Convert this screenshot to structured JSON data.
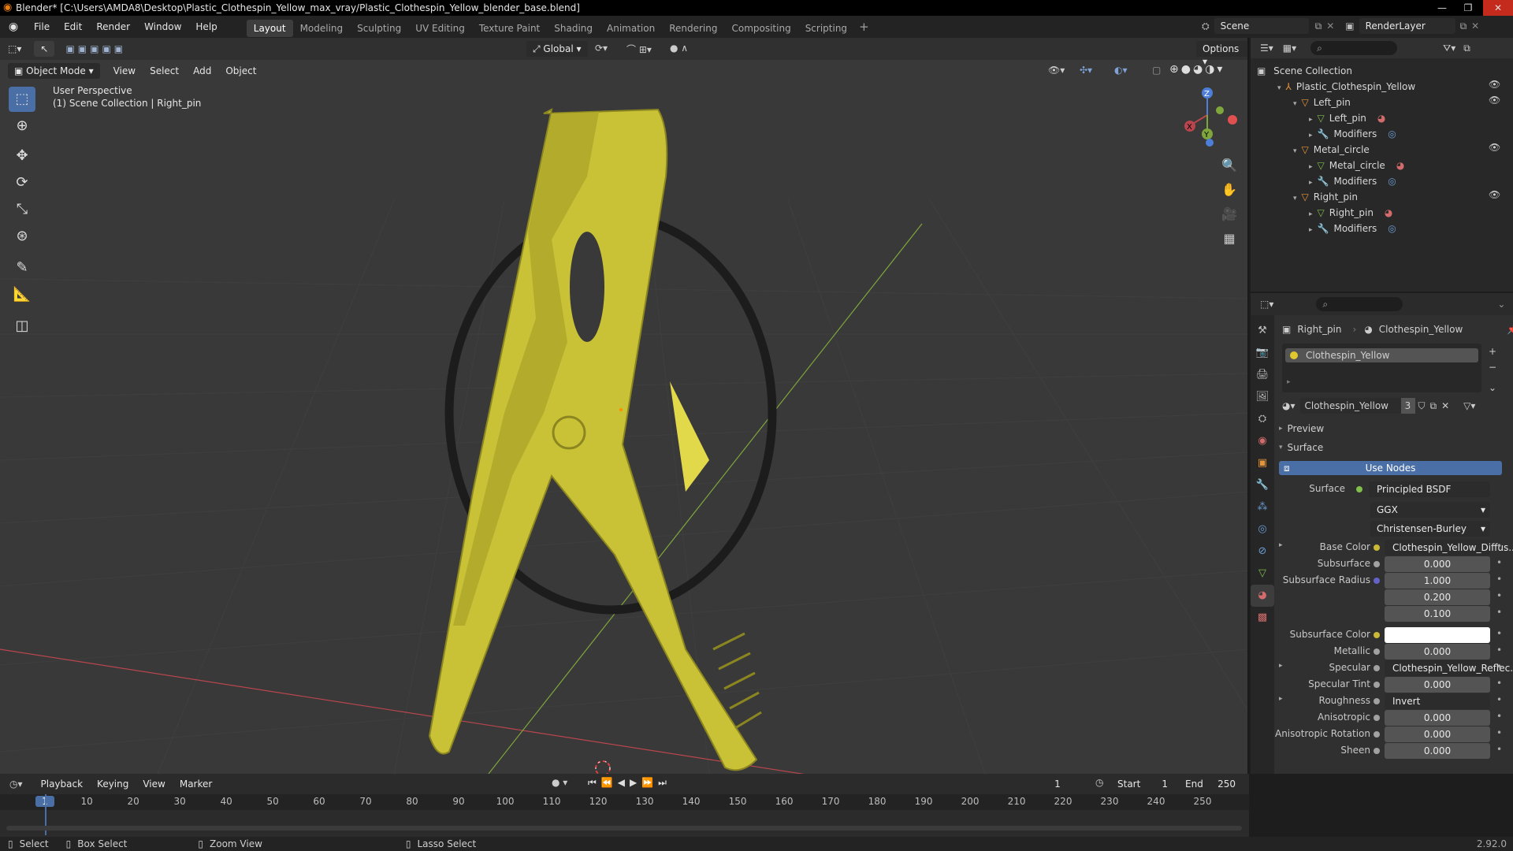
{
  "title_bar": {
    "text": "Blender* [C:\\Users\\AMDA8\\Desktop\\Plastic_Clothespin_Yellow_max_vray/Plastic_Clothespin_Yellow_blender_base.blend]"
  },
  "menu": [
    "File",
    "Edit",
    "Render",
    "Window",
    "Help"
  ],
  "workspaces": [
    {
      "label": "Layout",
      "active": true
    },
    {
      "label": "Modeling"
    },
    {
      "label": "Sculpting"
    },
    {
      "label": "UV Editing"
    },
    {
      "label": "Texture Paint"
    },
    {
      "label": "Shading"
    },
    {
      "label": "Animation"
    },
    {
      "label": "Rendering"
    },
    {
      "label": "Compositing"
    },
    {
      "label": "Scripting"
    }
  ],
  "scene_field": "Scene",
  "renderlayer_field": "RenderLayer",
  "viewport": {
    "mode": "Object Mode",
    "menus": [
      "View",
      "Select",
      "Add",
      "Object"
    ],
    "transform": "Global",
    "options": "Options",
    "overlay_line1": "User Perspective",
    "overlay_line2": "(1) Scene Collection | Right_pin",
    "gizmo": {
      "x": "X",
      "y": "Y",
      "z": "Z"
    }
  },
  "outliner": {
    "root": "Scene Collection",
    "items": [
      {
        "label": "Plastic_Clothespin_Yellow",
        "indent": 1,
        "kind": "empty"
      },
      {
        "label": "Left_pin",
        "indent": 2,
        "kind": "object"
      },
      {
        "label": "Left_pin",
        "indent": 3,
        "kind": "mesh"
      },
      {
        "label": "Modifiers",
        "indent": 3,
        "kind": "modifier"
      },
      {
        "label": "Metal_circle",
        "indent": 2,
        "kind": "object"
      },
      {
        "label": "Metal_circle",
        "indent": 3,
        "kind": "mesh"
      },
      {
        "label": "Modifiers",
        "indent": 3,
        "kind": "modifier"
      },
      {
        "label": "Right_pin",
        "indent": 2,
        "kind": "object"
      },
      {
        "label": "Right_pin",
        "indent": 3,
        "kind": "mesh"
      },
      {
        "label": "Modifiers",
        "indent": 3,
        "kind": "modifier"
      }
    ]
  },
  "properties": {
    "breadcrumb_object": "Right_pin",
    "breadcrumb_material": "Clothespin_Yellow",
    "slot": "Clothespin_Yellow",
    "material_name": "Clothespin_Yellow",
    "users": "3",
    "preview": "Preview",
    "surface_panel": "Surface",
    "use_nodes": "Use Nodes",
    "surface_label": "Surface",
    "surface_value": "Principled BSDF",
    "distribution": "GGX",
    "subsurface_method": "Christensen-Burley",
    "rows": [
      {
        "label": "Base Color",
        "value": "Clothespin_Yellow_Diffus...",
        "type": "link",
        "expand": true,
        "dot": "#c9b934"
      },
      {
        "label": "Subsurface",
        "value": "0.000",
        "type": "num",
        "dot": "#a1a1a1"
      },
      {
        "label": "Subsurface Radius",
        "value": "1.000",
        "type": "num",
        "dot": "#6363c7"
      },
      {
        "label": "",
        "value": "0.200",
        "type": "num"
      },
      {
        "label": "",
        "value": "0.100",
        "type": "num"
      },
      {
        "label": "Subsurface Color",
        "value": "",
        "type": "color",
        "dot": "#c9b934"
      },
      {
        "label": "Metallic",
        "value": "0.000",
        "type": "num",
        "dot": "#a1a1a1"
      },
      {
        "label": "Specular",
        "value": "Clothespin_Yellow_Reflec...",
        "type": "link",
        "expand": true,
        "dot": "#a1a1a1"
      },
      {
        "label": "Specular Tint",
        "value": "0.000",
        "type": "num",
        "dot": "#a1a1a1"
      },
      {
        "label": "Roughness",
        "value": "Invert",
        "type": "link",
        "expand": true,
        "dot": "#a1a1a1"
      },
      {
        "label": "Anisotropic",
        "value": "0.000",
        "type": "num",
        "dot": "#a1a1a1"
      },
      {
        "label": "Anisotropic Rotation",
        "value": "0.000",
        "type": "num",
        "dot": "#a1a1a1"
      },
      {
        "label": "Sheen",
        "value": "0.000",
        "type": "num",
        "dot": "#a1a1a1"
      }
    ]
  },
  "timeline": {
    "menus": [
      "Playback",
      "Keying",
      "View",
      "Marker"
    ],
    "current_frame": "1",
    "start_label": "Start",
    "start": "1",
    "end_label": "End",
    "end": "250",
    "ticks": [
      "1",
      "10",
      "20",
      "30",
      "40",
      "50",
      "60",
      "70",
      "80",
      "90",
      "100",
      "110",
      "120",
      "130",
      "140",
      "150",
      "160",
      "170",
      "180",
      "190",
      "200",
      "210",
      "220",
      "230",
      "240",
      "250"
    ]
  },
  "status": {
    "select": "Select",
    "box_select": "Box Select",
    "zoom_view": "Zoom View",
    "lasso_select": "Lasso Select",
    "version": "2.92.0"
  },
  "colors": {
    "accent_blue": "#4a6ea6",
    "clothespin_yellow": "#c9c236",
    "ring": "#1d1d1d",
    "axis_x": "#b9464e",
    "axis_y": "#7fa63c"
  }
}
